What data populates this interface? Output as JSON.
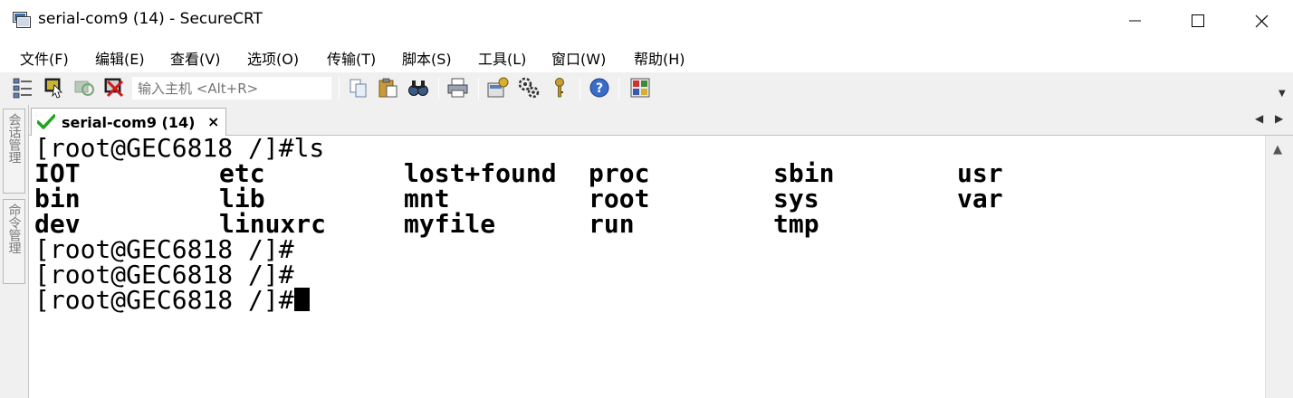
{
  "window": {
    "title": "serial-com9 (14) - SecureCRT"
  },
  "menu": {
    "items": [
      "文件(F)",
      "编辑(E)",
      "查看(V)",
      "选项(O)",
      "传输(T)",
      "脚本(S)",
      "工具(L)",
      "窗口(W)",
      "帮助(H)"
    ]
  },
  "toolbar": {
    "host_placeholder": "输入主机 <Alt+R>"
  },
  "sidepanel": {
    "session_manager": "会话管理",
    "command_manager": "命令管理"
  },
  "tab": {
    "label": "serial-com9 (14)",
    "close_glyph": "×"
  },
  "terminal": {
    "command_line": "[root@GEC6818 /]#ls",
    "ls_rows": [
      [
        "IOT",
        "etc",
        "lost+found",
        "proc",
        "sbin",
        "usr"
      ],
      [
        "bin",
        "lib",
        "mnt",
        "root",
        "sys",
        "var"
      ],
      [
        "dev",
        "linuxrc",
        "myfile",
        "run",
        "tmp",
        ""
      ]
    ],
    "prompt": "[root@GEC6818 /]#"
  },
  "colors": {
    "accent_green": "#1fa51f",
    "window_bg": "#ffffff",
    "toolbar_bg": "#f0f0f0"
  }
}
